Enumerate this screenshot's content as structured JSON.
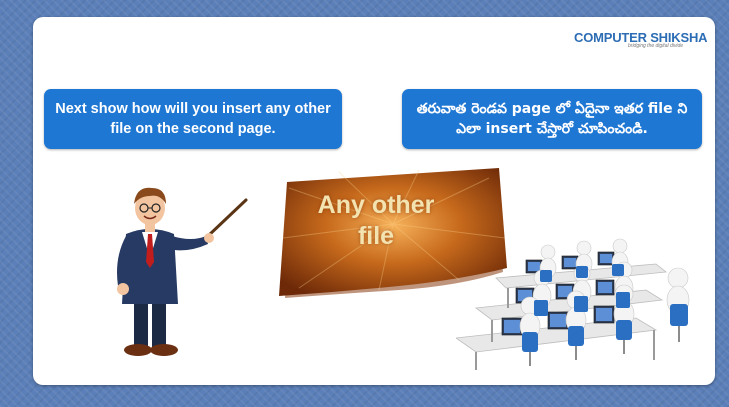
{
  "logo": {
    "part1": "COMPUTER",
    "part2": " SHIKSHA",
    "tagline": "bridging the digital divide"
  },
  "instruction_en": "Next show how will you insert any other file on the second page.",
  "instruction_te": "తరువాత రెండవ page లో ఏదైనా ఇతర file ని ఎలా insert చేస్తారో చూపించండి.",
  "banner": {
    "line1": "Any other",
    "line2": "file"
  },
  "colors": {
    "bubble": "#1f77d4",
    "background": "#5b7fb8",
    "banner_text": "#f3e3b0"
  }
}
